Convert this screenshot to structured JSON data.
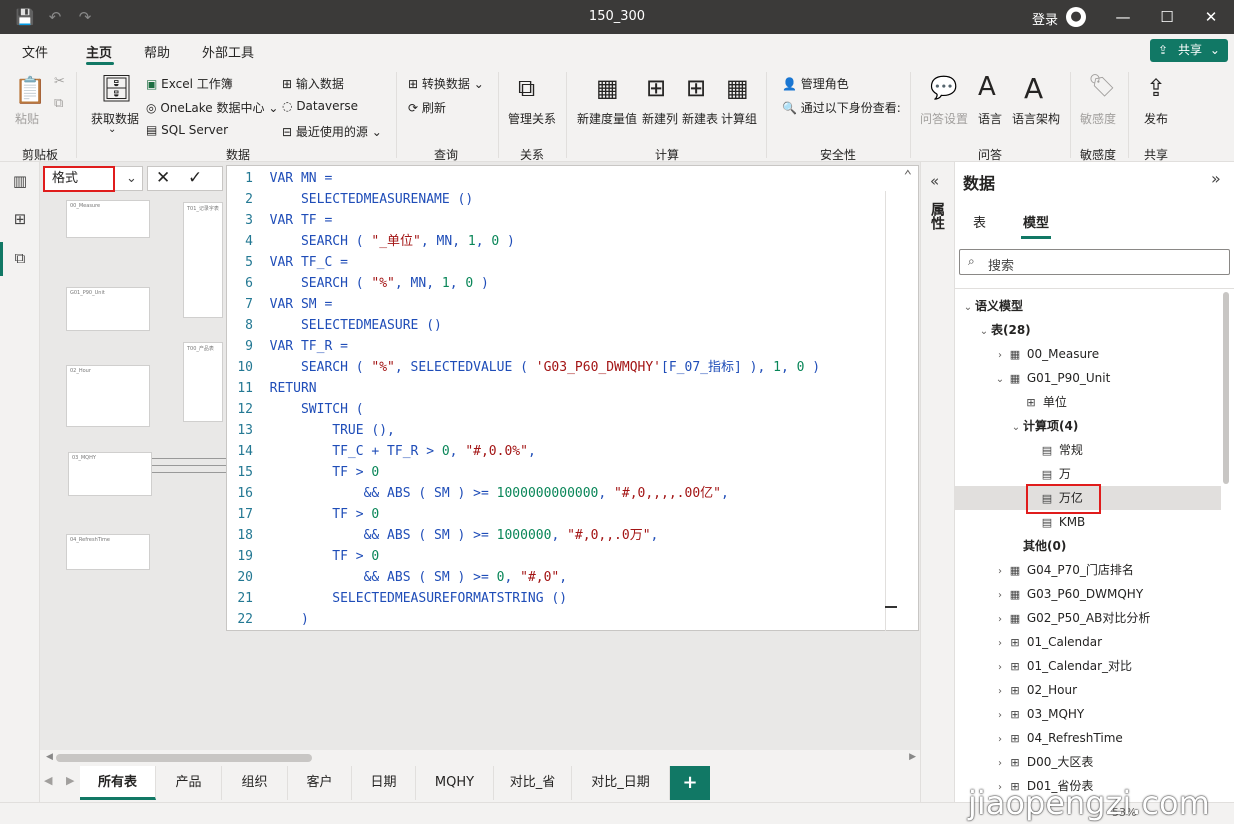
{
  "window": {
    "title": "150_300",
    "signin_label": "登录"
  },
  "menu": {
    "items": [
      "文件",
      "主页",
      "帮助",
      "外部工具"
    ],
    "share_label": "共享"
  },
  "ribbon": {
    "paste": "粘贴",
    "get_data": "获取数据",
    "excel": "Excel 工作簿",
    "onelake": "OneLake 数据中心",
    "sql": "SQL Server",
    "enter_data": "输入数据",
    "dataverse": "Dataverse",
    "recent": "最近使用的源",
    "transform": "转换数据",
    "refresh": "刷新",
    "manage_rel": "管理关系",
    "new_measure": "新建度量值",
    "new_column": "新建列",
    "new_table": "新建表",
    "calc_group": "计算组",
    "manage_roles": "管理角色",
    "view_as": "通过以下身份查看:",
    "qa_setup": "问答设置",
    "language": "语言",
    "linguistic": "语言架构",
    "sensitivity": "敏感度",
    "publish": "发布",
    "groups": {
      "clipboard": "剪贴板",
      "data": "数据",
      "queries": "查询",
      "relationships": "关系",
      "calculations": "计算",
      "security": "安全性",
      "qa": "问答",
      "sensitivity": "敏感度",
      "share": "共享"
    }
  },
  "formula": {
    "property": "格式"
  },
  "code": [
    {
      "n": "1",
      "t": [
        [
          "kw",
          "VAR "
        ],
        [
          "plain",
          "MN ="
        ]
      ]
    },
    {
      "n": "2",
      "t": [
        [
          "plain",
          "    SELECTEDMEASURENAME ()"
        ]
      ]
    },
    {
      "n": "3",
      "t": [
        [
          "kw",
          "VAR "
        ],
        [
          "plain",
          "TF ="
        ]
      ]
    },
    {
      "n": "4",
      "t": [
        [
          "plain",
          "    SEARCH ( "
        ],
        [
          "str",
          "\"_单位\""
        ],
        [
          "plain",
          ", MN, "
        ],
        [
          "num",
          "1"
        ],
        [
          "plain",
          ", "
        ],
        [
          "num",
          "0"
        ],
        [
          "plain",
          " )"
        ]
      ]
    },
    {
      "n": "5",
      "t": [
        [
          "kw",
          "VAR "
        ],
        [
          "plain",
          "TF_C ="
        ]
      ]
    },
    {
      "n": "6",
      "t": [
        [
          "plain",
          "    SEARCH ( "
        ],
        [
          "str",
          "\"%\""
        ],
        [
          "plain",
          ", MN, "
        ],
        [
          "num",
          "1"
        ],
        [
          "plain",
          ", "
        ],
        [
          "num",
          "0"
        ],
        [
          "plain",
          " )"
        ]
      ]
    },
    {
      "n": "7",
      "t": [
        [
          "kw",
          "VAR "
        ],
        [
          "plain",
          "SM ="
        ]
      ]
    },
    {
      "n": "8",
      "t": [
        [
          "plain",
          "    SELECTEDMEASURE ()"
        ]
      ]
    },
    {
      "n": "9",
      "t": [
        [
          "kw",
          "VAR "
        ],
        [
          "plain",
          "TF_R ="
        ]
      ]
    },
    {
      "n": "10",
      "t": [
        [
          "plain",
          "    SEARCH ( "
        ],
        [
          "str",
          "\"%\""
        ],
        [
          "plain",
          ", SELECTEDVALUE ( "
        ],
        [
          "str",
          "'G03_P60_DWMQHY'"
        ],
        [
          "plain",
          "[F_07_指标] ), "
        ],
        [
          "num",
          "1"
        ],
        [
          "plain",
          ", "
        ],
        [
          "num",
          "0"
        ],
        [
          "plain",
          " )"
        ]
      ]
    },
    {
      "n": "11",
      "t": [
        [
          "kw",
          "RETURN"
        ]
      ]
    },
    {
      "n": "12",
      "t": [
        [
          "plain",
          "    SWITCH ("
        ]
      ]
    },
    {
      "n": "13",
      "t": [
        [
          "plain",
          "        TRUE (),"
        ]
      ]
    },
    {
      "n": "14",
      "t": [
        [
          "plain",
          "        TF_C + TF_R > "
        ],
        [
          "num",
          "0"
        ],
        [
          "plain",
          ", "
        ],
        [
          "str",
          "\"#,0.0%\""
        ],
        [
          "plain",
          ","
        ]
      ]
    },
    {
      "n": "15",
      "t": [
        [
          "plain",
          "        TF > "
        ],
        [
          "num",
          "0"
        ]
      ]
    },
    {
      "n": "16",
      "t": [
        [
          "plain",
          "            && ABS ( SM ) >= "
        ],
        [
          "num",
          "1000000000000"
        ],
        [
          "plain",
          ", "
        ],
        [
          "str",
          "\"#,0,,,,.00亿\""
        ],
        [
          "plain",
          ","
        ]
      ]
    },
    {
      "n": "17",
      "t": [
        [
          "plain",
          "        TF > "
        ],
        [
          "num",
          "0"
        ]
      ]
    },
    {
      "n": "18",
      "t": [
        [
          "plain",
          "            && ABS ( SM ) >= "
        ],
        [
          "num",
          "1000000"
        ],
        [
          "plain",
          ", "
        ],
        [
          "str",
          "\"#,0,,.0万\""
        ],
        [
          "plain",
          ","
        ]
      ]
    },
    {
      "n": "19",
      "t": [
        [
          "plain",
          "        TF > "
        ],
        [
          "num",
          "0"
        ]
      ]
    },
    {
      "n": "20",
      "t": [
        [
          "plain",
          "            && ABS ( SM ) >= "
        ],
        [
          "num",
          "0"
        ],
        [
          "plain",
          ", "
        ],
        [
          "str",
          "\"#,0\""
        ],
        [
          "plain",
          ","
        ]
      ]
    },
    {
      "n": "21",
      "t": [
        [
          "plain",
          "        SELECTEDMEASUREFORMATSTRING ()"
        ]
      ]
    },
    {
      "n": "22",
      "t": [
        [
          "plain",
          "    )"
        ]
      ]
    }
  ],
  "data_pane": {
    "title": "数据",
    "tab_table": "表",
    "tab_model": "模型",
    "search_placeholder": "搜索",
    "properties_label": "属性",
    "tree": [
      {
        "label": "语义模型",
        "depth": 0,
        "chev": "v",
        "icon": ""
      },
      {
        "label": "表(28)",
        "depth": 1,
        "chev": "v",
        "icon": ""
      },
      {
        "label": "00_Measure",
        "depth": 2,
        "chev": ">",
        "icon": "▦"
      },
      {
        "label": "G01_P90_Unit",
        "depth": 2,
        "chev": "v",
        "icon": "▦"
      },
      {
        "label": "单位",
        "depth": 3,
        "chev": "",
        "icon": "⊞"
      },
      {
        "label": "计算项(4)",
        "depth": 3,
        "chev": "v",
        "icon": ""
      },
      {
        "label": "常规",
        "depth": 4,
        "chev": "",
        "icon": "▤"
      },
      {
        "label": "万",
        "depth": 4,
        "chev": "",
        "icon": "▤"
      },
      {
        "label": "万亿",
        "depth": 4,
        "chev": "",
        "icon": "▤",
        "selected": true
      },
      {
        "label": "KMB",
        "depth": 4,
        "chev": "",
        "icon": "▤"
      },
      {
        "label": "其他(0)",
        "depth": 3,
        "chev": "",
        "icon": ""
      },
      {
        "label": "G04_P70_门店排名",
        "depth": 2,
        "chev": ">",
        "icon": "▦"
      },
      {
        "label": "G03_P60_DWMQHY",
        "depth": 2,
        "chev": ">",
        "icon": "▦"
      },
      {
        "label": "G02_P50_AB对比分析",
        "depth": 2,
        "chev": ">",
        "icon": "▦"
      },
      {
        "label": "01_Calendar",
        "depth": 2,
        "chev": ">",
        "icon": "⊞"
      },
      {
        "label": "01_Calendar_对比",
        "depth": 2,
        "chev": ">",
        "icon": "⊞"
      },
      {
        "label": "02_Hour",
        "depth": 2,
        "chev": ">",
        "icon": "⊞"
      },
      {
        "label": "03_MQHY",
        "depth": 2,
        "chev": ">",
        "icon": "⊞"
      },
      {
        "label": "04_RefreshTime",
        "depth": 2,
        "chev": ">",
        "icon": "⊞"
      },
      {
        "label": "D00_大区表",
        "depth": 2,
        "chev": ">",
        "icon": "⊞"
      },
      {
        "label": "D01_省份表",
        "depth": 2,
        "chev": ">",
        "icon": "⊞"
      }
    ]
  },
  "diagram_cards": [
    "00_Measure",
    "T01_记录字表",
    "G01_P90_Unit",
    "T00_产品表",
    "02_Hour",
    "03_MQHY",
    "04_RefreshTime"
  ],
  "page_tabs": [
    "所有表",
    "产品",
    "组织",
    "客户",
    "日期",
    "MQHY",
    "对比_省",
    "对比_日期"
  ],
  "status": {
    "zoom": "53%"
  },
  "watermark": "jiaopengzi.com"
}
